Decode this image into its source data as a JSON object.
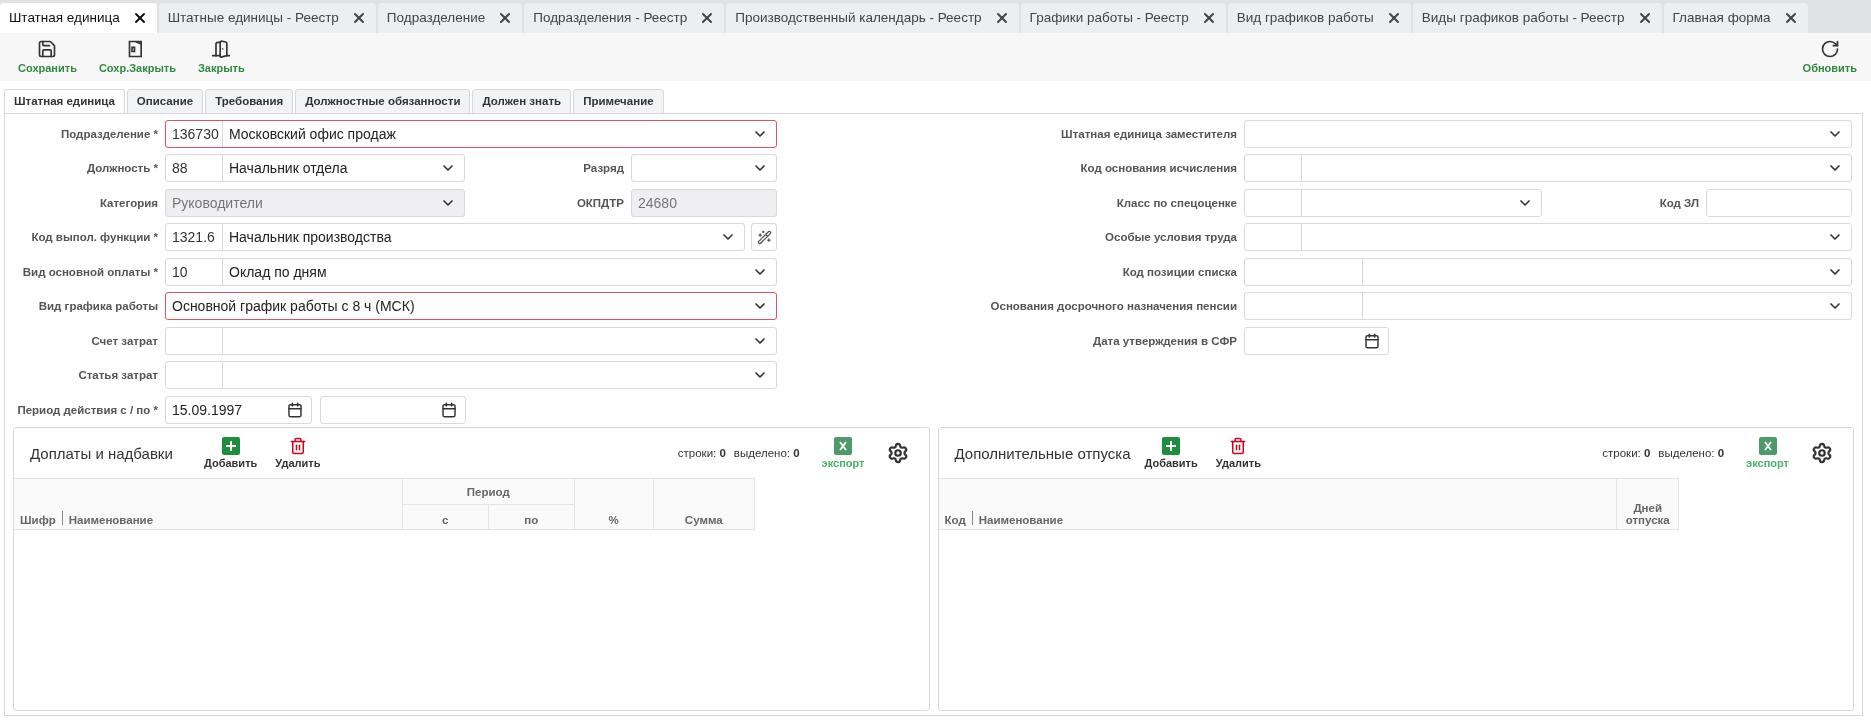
{
  "doc_tabs": [
    {
      "label": "Штатная единица",
      "selected": true
    },
    {
      "label": "Штатные единицы - Реестр",
      "selected": false
    },
    {
      "label": "Подразделение",
      "selected": false
    },
    {
      "label": "Подразделения - Реестр",
      "selected": false
    },
    {
      "label": "Производственный календарь - Реестр",
      "selected": false
    },
    {
      "label": "Графики работы - Реестр",
      "selected": false
    },
    {
      "label": "Вид графиков работы",
      "selected": false
    },
    {
      "label": "Виды графиков работы - Реестр",
      "selected": false
    },
    {
      "label": "Главная форма",
      "selected": false
    }
  ],
  "toolbar": {
    "left": [
      {
        "kind": "save",
        "label": "Сохранить"
      },
      {
        "kind": "save_close",
        "label": "Сохр.Закрыть"
      },
      {
        "kind": "close",
        "label": "Закрыть"
      }
    ],
    "right": [
      {
        "kind": "refresh",
        "label": "Обновить"
      }
    ]
  },
  "form_tabs": [
    {
      "label": "Штатная единица",
      "selected": true
    },
    {
      "label": "Описание",
      "selected": false
    },
    {
      "label": "Требования",
      "selected": false
    },
    {
      "label": "Должностные обязанности",
      "selected": false
    },
    {
      "label": "Должен знать",
      "selected": false
    },
    {
      "label": "Примечание",
      "selected": false
    }
  ],
  "left_rows": [
    {
      "fields": [
        {
          "label": "Подразделение *",
          "kind": "code_select",
          "code": "136730",
          "value": "Московский офис продаж",
          "invalid": true,
          "disabled": false
        }
      ]
    },
    {
      "fields": [
        {
          "label": "Должность *",
          "kind": "code_select",
          "code": "88",
          "value": "Начальник отдела",
          "invalid": false,
          "disabled": false
        },
        {
          "label": "Разряд",
          "kind": "select",
          "invalid": false,
          "disabled": false
        }
      ]
    },
    {
      "fields": [
        {
          "label": "Категория",
          "kind": "select",
          "value": "Руководители",
          "invalid": false,
          "disabled": true
        },
        {
          "label": "ОКПДТР",
          "kind": "text",
          "value": "24680",
          "invalid": false,
          "disabled": true
        }
      ]
    },
    {
      "fields": [
        {
          "label": "Код выпол. функции *",
          "kind": "code_select_action",
          "code": "1321.6",
          "value": "Начальник производства",
          "invalid": false,
          "disabled": false
        }
      ]
    },
    {
      "fields": [
        {
          "label": "Вид основной оплаты *",
          "kind": "code_select",
          "code": "10",
          "value": "Оклад по дням",
          "invalid": false,
          "disabled": false
        }
      ]
    },
    {
      "fields": [
        {
          "label": "Вид графика работы",
          "kind": "select",
          "value": "Основной график работы с 8 ч (МСК)",
          "invalid": true,
          "disabled": false
        }
      ]
    },
    {
      "fields": [
        {
          "label": "Счет затрат",
          "kind": "code_select",
          "invalid": false,
          "disabled": false
        }
      ]
    },
    {
      "fields": [
        {
          "label": "Статья затрат",
          "kind": "code_select",
          "invalid": false,
          "disabled": false
        }
      ]
    },
    {
      "fields": [
        {
          "label": "Период действия с / по *",
          "kind": "date_range",
          "value": "15.09.1997",
          "invalid": false,
          "disabled": false
        }
      ]
    }
  ],
  "right_rows": [
    {
      "fields": [
        {
          "label": "Штатная единица заместителя",
          "kind": "select",
          "invalid": false,
          "disabled": false
        }
      ]
    },
    {
      "fields": [
        {
          "label": "Код основания исчисления",
          "kind": "code_select",
          "invalid": false,
          "disabled": false
        }
      ]
    },
    {
      "fields": [
        {
          "label": "Класс по спецоценке",
          "kind": "code_select",
          "invalid": false,
          "disabled": false
        },
        {
          "label": "Код ЗЛ",
          "kind": "text",
          "invalid": false,
          "disabled": false
        }
      ]
    },
    {
      "fields": [
        {
          "label": "Особые условия труда",
          "kind": "code_select",
          "invalid": false,
          "disabled": false
        }
      ]
    },
    {
      "fields": [
        {
          "label": "Код позиции списка",
          "kind": "wide_code_select",
          "invalid": false,
          "disabled": false
        }
      ]
    },
    {
      "fields": [
        {
          "label": "Основания досрочного назначения пенсии",
          "kind": "wide_code_select",
          "invalid": false,
          "disabled": false
        }
      ]
    },
    {
      "fields": [
        {
          "label": "Дата утверждения в СФР",
          "kind": "date",
          "invalid": false,
          "disabled": false
        }
      ]
    }
  ],
  "panels": [
    {
      "title": "Доплаты и надбавки",
      "buttons": [
        {
          "kind": "add",
          "label": "Добавить"
        },
        {
          "kind": "delete",
          "label": "Удалить"
        }
      ],
      "rows_stat": "строки: **0**",
      "selected_stat": "выделено: **0**",
      "export": "экспорт",
      "columns": [
        {
          "kind": "main",
          "labels": [
            "Шифр",
            "Наименование"
          ]
        },
        {
          "kind": "group",
          "label": "Период",
          "children": [
            {
              "label": "с"
            },
            {
              "label": "по"
            }
          ]
        },
        {
          "kind": "narrow",
          "label": "%"
        },
        {
          "kind": "sum",
          "label": "Сумма"
        }
      ]
    },
    {
      "title": "Дополнительные отпуска",
      "buttons": [
        {
          "kind": "add",
          "label": "Добавить"
        },
        {
          "kind": "delete",
          "label": "Удалить"
        }
      ],
      "rows_stat": "строки: **0**",
      "selected_stat": "выделено: **0**",
      "export": "экспорт",
      "columns": [
        {
          "kind": "main",
          "labels": [
            "Код",
            "Наименование"
          ]
        },
        {
          "kind": "days",
          "label": "Дней отпуска"
        }
      ]
    }
  ]
}
